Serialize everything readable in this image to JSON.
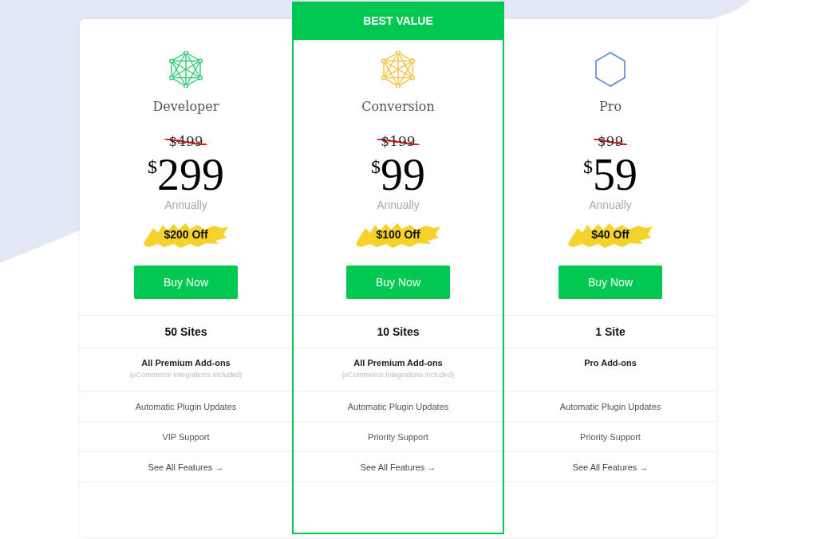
{
  "plans": [
    {
      "name": "Developer",
      "featured": false,
      "kind": "network",
      "color": "#2ecc71",
      "old_price": "$499",
      "currency": "$",
      "price": "299",
      "period": "Annually",
      "discount": "$200 Off",
      "button": "Buy Now",
      "features": [
        {
          "kind": "bold",
          "text": "50 Sites"
        },
        {
          "kind": "addon",
          "text": "All Premium Add-ons",
          "note": "(eCommerce Integrations included)"
        },
        {
          "kind": "plain",
          "text": "Automatic Plugin Updates"
        },
        {
          "kind": "plain",
          "text": "VIP Support"
        },
        {
          "kind": "link",
          "text": "See All Features →"
        }
      ]
    },
    {
      "name": "Conversion",
      "featured": true,
      "badge": "BEST VALUE",
      "kind": "network",
      "color": "#f5c242",
      "old_price": "$199",
      "currency": "$",
      "price": "99",
      "period": "Annually",
      "discount": "$100 Off",
      "button": "Buy Now",
      "features": [
        {
          "kind": "bold",
          "text": "10 Sites"
        },
        {
          "kind": "addon",
          "text": "All Premium Add-ons",
          "note": "(eCommerce Integrations included)"
        },
        {
          "kind": "plain",
          "text": "Automatic Plugin Updates"
        },
        {
          "kind": "plain",
          "text": "Priority Support"
        },
        {
          "kind": "link",
          "text": "See All Features →"
        }
      ]
    },
    {
      "name": "Pro",
      "featured": false,
      "kind": "hexagon",
      "color": "#5b86d6",
      "old_price": "$99",
      "currency": "$",
      "price": "59",
      "period": "Annually",
      "discount": "$40 Off",
      "button": "Buy Now",
      "features": [
        {
          "kind": "bold",
          "text": "1 Site"
        },
        {
          "kind": "addon",
          "text": "Pro Add-ons"
        },
        {
          "kind": "plain",
          "text": "Automatic Plugin Updates"
        },
        {
          "kind": "plain",
          "text": "Priority Support"
        },
        {
          "kind": "link",
          "text": "See All Features →"
        }
      ]
    }
  ]
}
